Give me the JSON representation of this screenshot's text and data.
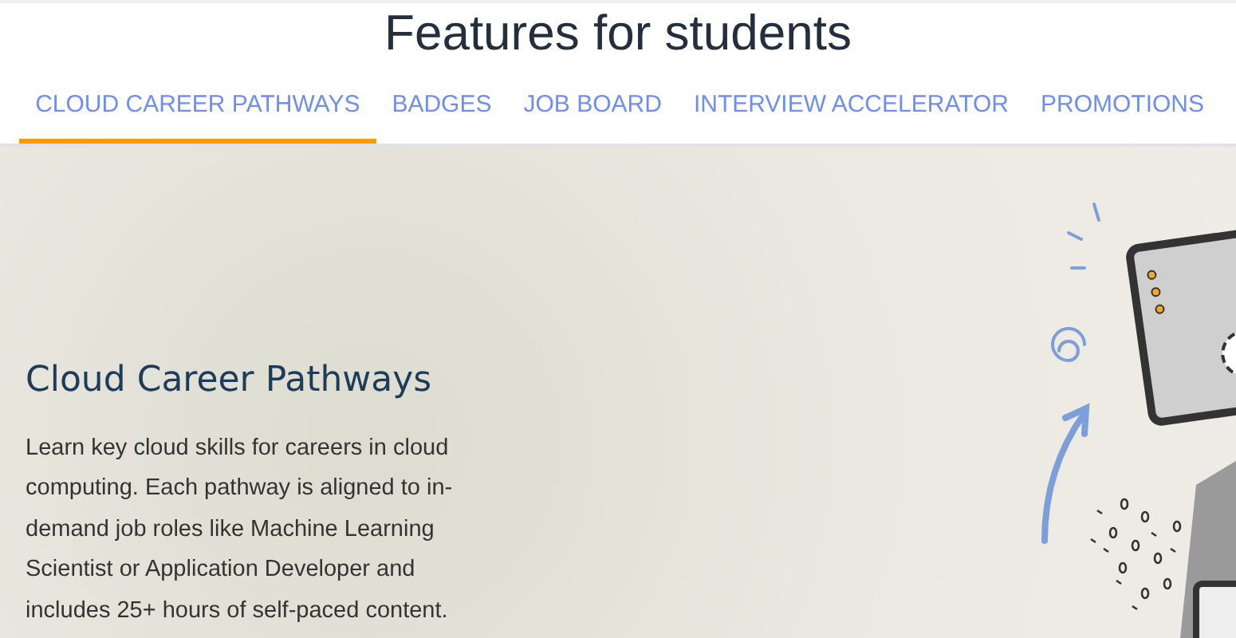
{
  "title": "Features for students",
  "tabs": [
    {
      "label": "CLOUD CAREER PATHWAYS",
      "selected": true
    },
    {
      "label": "BADGES",
      "selected": false
    },
    {
      "label": "JOB BOARD",
      "selected": false
    },
    {
      "label": "INTERVIEW ACCELERATOR",
      "selected": false
    },
    {
      "label": "PROMOTIONS",
      "selected": false
    }
  ],
  "hero": {
    "heading": "Cloud Career Pathways",
    "body": "Learn key cloud skills for careers in cloud computing. Each pathway is aligned to in-demand job roles like Machine Learning Scientist or Application Developer and includes 25+ hours of self-paced content."
  }
}
